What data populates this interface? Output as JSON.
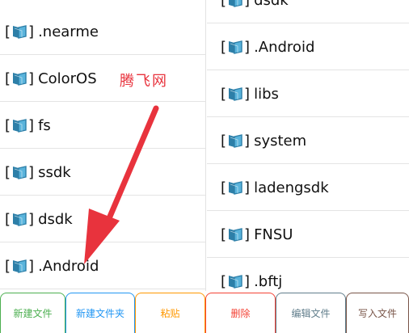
{
  "left_pane": {
    "items": [
      {
        "name": ".nearme"
      },
      {
        "name": "ColorOS"
      },
      {
        "name": "fs"
      },
      {
        "name": "ssdk"
      },
      {
        "name": "dsdk"
      },
      {
        "name": ".Android"
      }
    ]
  },
  "right_pane": {
    "items": [
      {
        "name": "dsdk"
      },
      {
        "name": ".Android"
      },
      {
        "name": "libs"
      },
      {
        "name": "system"
      },
      {
        "name": "ladengsdk"
      },
      {
        "name": "FNSU"
      },
      {
        "name": ".bftj"
      }
    ]
  },
  "bracket_open": "[",
  "bracket_close": "]",
  "watermark": "腾飞网",
  "toolbar": {
    "buttons": [
      {
        "label": "新建文件",
        "color": "#4caf50"
      },
      {
        "label": "新建文件夹",
        "color": "#2196f3"
      },
      {
        "label": "粘贴",
        "color": "#ff9800"
      },
      {
        "label": "删除",
        "color": "#f44336"
      },
      {
        "label": "编辑文件",
        "color": "#607d8b"
      },
      {
        "label": "写入文件",
        "color": "#795548"
      }
    ]
  },
  "colors": {
    "folder_fill": "#5ab4dc",
    "folder_dark": "#2d7fa8",
    "arrow": "#e8333d",
    "watermark": "#e8333d"
  },
  "icons": {
    "folder": "folder-icon",
    "arrow": "pointer-arrow"
  }
}
